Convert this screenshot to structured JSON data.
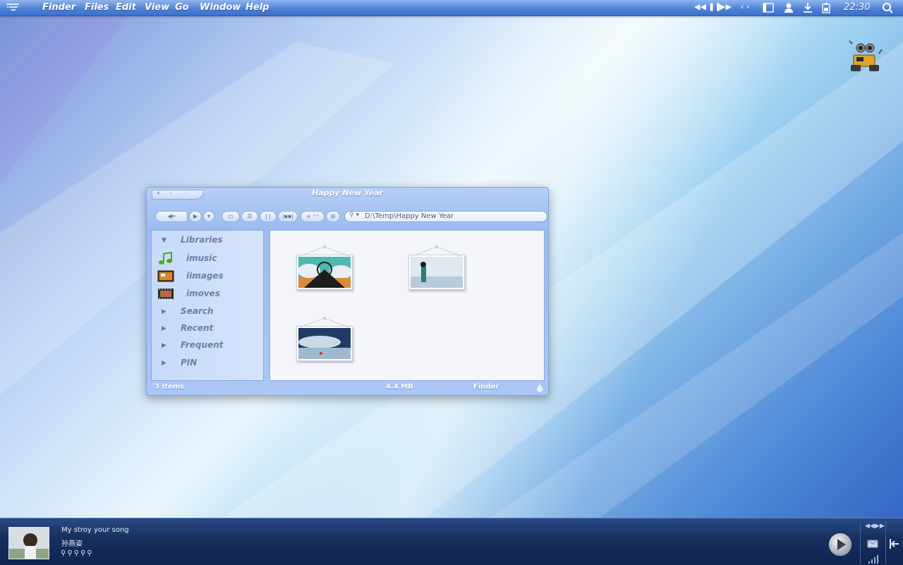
{
  "menubar": {
    "app_name": "Finder",
    "menus": [
      "Files",
      "Edit",
      "View",
      "Go",
      "Window",
      "Help"
    ],
    "clock": "22:30"
  },
  "window": {
    "title": "Happy New Year",
    "path": "D:\\Temp\\Happy New Year",
    "sidebar": {
      "libraries_label": "Libraries",
      "libraries": [
        {
          "label": "imusic",
          "icon": "music-note-icon"
        },
        {
          "label": "iimages",
          "icon": "image-folder-icon"
        },
        {
          "label": "imoves",
          "icon": "film-strip-icon"
        }
      ],
      "sections": [
        "Search",
        "Recent",
        "Frequent",
        "PIN"
      ]
    },
    "status": {
      "items": "3 Items",
      "size": "4.4 MB",
      "app": "Finder"
    }
  },
  "player": {
    "song": "My stroy your song",
    "artist": "孙燕姿"
  },
  "colors": {
    "menubar": "#4f83d8",
    "window": "#9cbcf0",
    "player": "#17305f"
  }
}
